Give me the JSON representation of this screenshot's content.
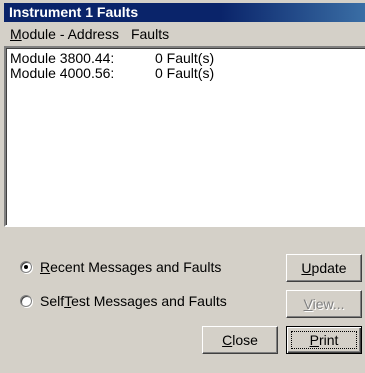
{
  "window": {
    "title": "Instrument 1 Faults"
  },
  "menu": {
    "items": [
      {
        "label": "Module - Address"
      },
      {
        "label": "Faults"
      }
    ]
  },
  "faults_list": {
    "rows": [
      {
        "module": "Module 3800.44:",
        "faults": "0 Fault(s)"
      },
      {
        "module": "Module 4000.56:",
        "faults": "0 Fault(s)"
      }
    ]
  },
  "options": {
    "recent_label": "Recent Messages and Faults",
    "selftest_label": "SelfTest Messages and Faults",
    "selected": "recent"
  },
  "buttons": {
    "update": "Update",
    "view": "View...",
    "close": "Close",
    "print": "Print"
  },
  "colors": {
    "titlebar": "#0a246a",
    "face": "#d4d0c8"
  }
}
